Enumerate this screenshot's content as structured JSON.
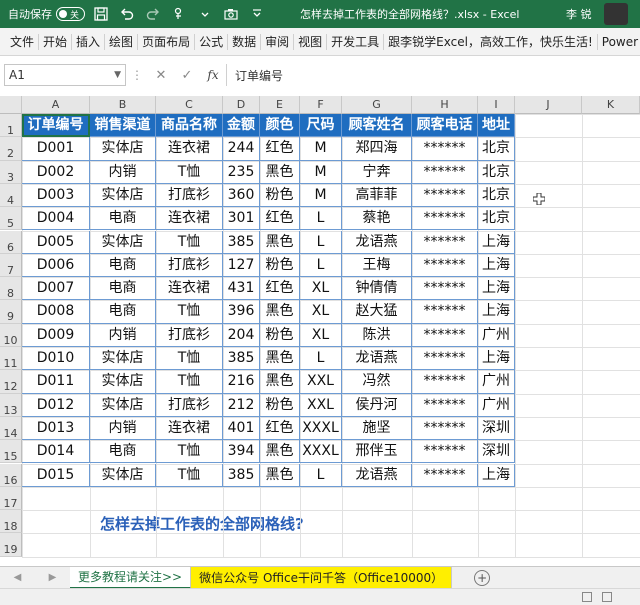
{
  "titlebar": {
    "autosave_label": "自动保存",
    "autosave_state": "关",
    "doc_title": "怎样去掉工作表的全部网格线？.xlsx  -  Excel",
    "user": "李 锐"
  },
  "menu": [
    "文件",
    "开始",
    "插入",
    "绘图",
    "页面布局",
    "公式",
    "数据",
    "审阅",
    "视图",
    "开发工具",
    "跟李锐学Excel，高效工作，快乐生活!",
    "Power P"
  ],
  "formula_bar": {
    "name_box": "A1",
    "formula": "订单编号",
    "fx": "fx",
    "cancel": "✕",
    "enter": "✓"
  },
  "columns": [
    "A",
    "B",
    "C",
    "D",
    "E",
    "F",
    "G",
    "H",
    "I",
    "J",
    "K"
  ],
  "rows": [
    "1",
    "2",
    "3",
    "4",
    "5",
    "6",
    "7",
    "8",
    "9",
    "10",
    "11",
    "12",
    "13",
    "14",
    "15",
    "16",
    "17",
    "18",
    "19"
  ],
  "table": {
    "headers": [
      "订单编号",
      "销售渠道",
      "商品名称",
      "金额",
      "颜色",
      "尺码",
      "顾客姓名",
      "顾客电话",
      "地址"
    ],
    "rows": [
      [
        "D001",
        "实体店",
        "连衣裙",
        "244",
        "红色",
        "M",
        "郑四海",
        "******",
        "北京"
      ],
      [
        "D002",
        "内销",
        "T恤",
        "235",
        "黑色",
        "M",
        "宁奔",
        "******",
        "北京"
      ],
      [
        "D003",
        "实体店",
        "打底衫",
        "360",
        "粉色",
        "M",
        "高菲菲",
        "******",
        "北京"
      ],
      [
        "D004",
        "电商",
        "连衣裙",
        "301",
        "红色",
        "L",
        "蔡艳",
        "******",
        "北京"
      ],
      [
        "D005",
        "实体店",
        "T恤",
        "385",
        "黑色",
        "L",
        "龙语燕",
        "******",
        "上海"
      ],
      [
        "D006",
        "电商",
        "打底衫",
        "127",
        "粉色",
        "L",
        "王梅",
        "******",
        "上海"
      ],
      [
        "D007",
        "电商",
        "连衣裙",
        "431",
        "红色",
        "XL",
        "钟倩倩",
        "******",
        "上海"
      ],
      [
        "D008",
        "电商",
        "T恤",
        "396",
        "黑色",
        "XL",
        "赵大猛",
        "******",
        "上海"
      ],
      [
        "D009",
        "内销",
        "打底衫",
        "204",
        "粉色",
        "XL",
        "陈洪",
        "******",
        "广州"
      ],
      [
        "D010",
        "实体店",
        "T恤",
        "385",
        "黑色",
        "L",
        "龙语燕",
        "******",
        "上海"
      ],
      [
        "D011",
        "实体店",
        "T恤",
        "216",
        "黑色",
        "XXL",
        "冯然",
        "******",
        "广州"
      ],
      [
        "D012",
        "实体店",
        "打底衫",
        "212",
        "粉色",
        "XXL",
        "侯丹河",
        "******",
        "广州"
      ],
      [
        "D013",
        "内销",
        "连衣裙",
        "401",
        "红色",
        "XXXL",
        "施坚",
        "******",
        "深圳"
      ],
      [
        "D014",
        "电商",
        "T恤",
        "394",
        "黑色",
        "XXXL",
        "邢伴玉",
        "******",
        "深圳"
      ],
      [
        "D015",
        "实体店",
        "T恤",
        "385",
        "黑色",
        "L",
        "龙语燕",
        "******",
        "上海"
      ]
    ]
  },
  "note": "怎样去掉工作表的全部网格线?",
  "sheets": [
    {
      "label": "更多教程请关注>>",
      "style": "active"
    },
    {
      "label": "微信公众号 Office干问千答（Office10000）",
      "style": "yellow"
    }
  ],
  "colors": {
    "excel_green": "#217346",
    "header_blue": "#1f6dc0",
    "note_blue": "#2a60b8",
    "tab_yellow": "#ffef00"
  }
}
